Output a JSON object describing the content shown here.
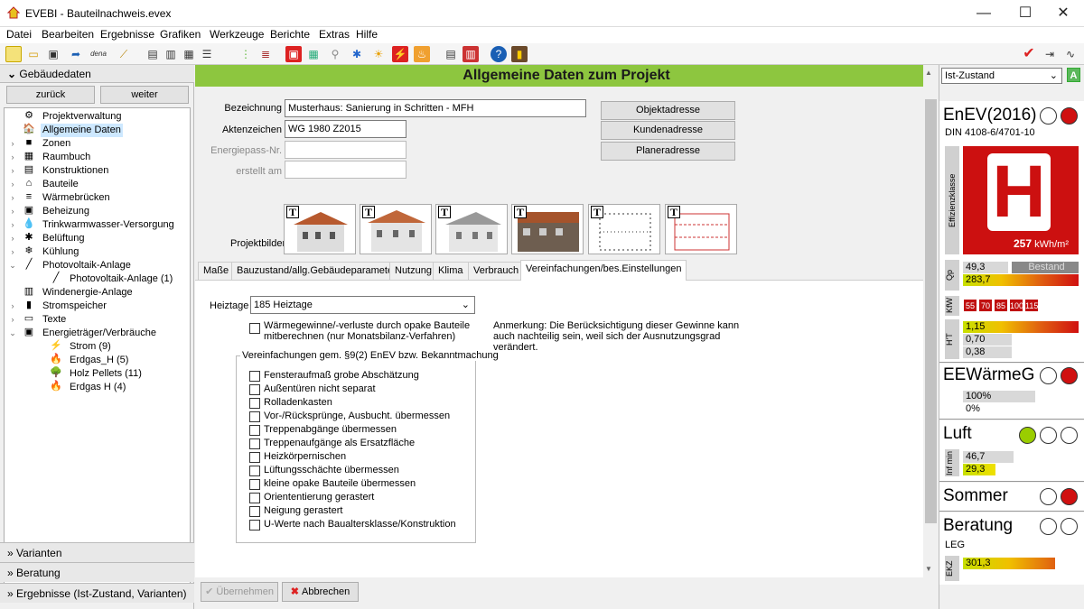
{
  "window": {
    "title": "EVEBI - Bauteilnachweis.evex",
    "minimize": "—",
    "maximize": "☐",
    "close": "✕"
  },
  "menu": [
    "Datei",
    "Bearbeiten",
    "Ergebnisse",
    "Grafiken",
    "Werkzeuge",
    "Berichte",
    "Extras",
    "Hilfe"
  ],
  "toolbar_dena": "dena",
  "left": {
    "header": "Gebäudedaten",
    "back": "zurück",
    "forward": "weiter",
    "tree": [
      {
        "label": "Projektverwaltung",
        "icon": "⚙",
        "exp": ""
      },
      {
        "label": "Allgemeine Daten",
        "icon": "🏠",
        "exp": "",
        "selected": true
      },
      {
        "label": "Zonen",
        "icon": "■",
        "exp": "›"
      },
      {
        "label": "Raumbuch",
        "icon": "▦",
        "exp": "›"
      },
      {
        "label": "Konstruktionen",
        "icon": "▤",
        "exp": "›"
      },
      {
        "label": "Bauteile",
        "icon": "⌂",
        "exp": "›"
      },
      {
        "label": "Wärmebrücken",
        "icon": "≡",
        "exp": "›"
      },
      {
        "label": "Beheizung",
        "icon": "▣",
        "exp": "›"
      },
      {
        "label": "Trinkwarmwasser-Versorgung",
        "icon": "💧",
        "exp": "›"
      },
      {
        "label": "Belüftung",
        "icon": "✱",
        "exp": "›"
      },
      {
        "label": "Kühlung",
        "icon": "❄",
        "exp": "›"
      },
      {
        "label": "Photovoltaik-Anlage",
        "icon": "╱",
        "exp": "⌄"
      },
      {
        "label": "Photovoltaik-Anlage (1)",
        "icon": "╱",
        "exp": "",
        "indent": true
      },
      {
        "label": "Windenergie-Anlage",
        "icon": "▥",
        "exp": ""
      },
      {
        "label": "Stromspeicher",
        "icon": "▮",
        "exp": "›"
      },
      {
        "label": "Texte",
        "icon": "▭",
        "exp": "›"
      },
      {
        "label": "Energieträger/Verbräuche",
        "icon": "▣",
        "exp": "⌄"
      },
      {
        "label": "Strom (9)",
        "icon": "⚡",
        "exp": "",
        "indent": true
      },
      {
        "label": "Erdgas_H (5)",
        "icon": "🔥",
        "exp": "",
        "indent": true
      },
      {
        "label": "Holz Pellets (11)",
        "icon": "🌳",
        "exp": "",
        "indent": true
      },
      {
        "label": "Erdgas H (4)",
        "icon": "🔥",
        "exp": "",
        "indent": true
      }
    ],
    "accordion": [
      "Varianten",
      "Beratung",
      "Ergebnisse (Ist-Zustand, Varianten)"
    ]
  },
  "main": {
    "header": "Allgemeine Daten zum Projekt",
    "fields": {
      "bezeichnung_label": "Bezeichnung",
      "bezeichnung_value": "Musterhaus: Sanierung in Schritten - MFH",
      "aktenzeichen_label": "Aktenzeichen",
      "aktenzeichen_value": "WG 1980 Z2015",
      "energiepass_label": "Energiepass-Nr.",
      "erstellt_label": "erstellt am"
    },
    "address_buttons": [
      "Objektadresse",
      "Kundenadresse",
      "Planeradresse"
    ],
    "projektbilder_label": "Projektbilder",
    "pic_t": "T",
    "tabs": [
      "Maße",
      "Bauzustand/allg.Gebäudeparameter",
      "Nutzung",
      "Klima",
      "Verbrauch",
      "Vereinfachungen/bes.Einstellungen"
    ],
    "heiztage_label": "Heiztage",
    "heiztage_value": "185 Heiztage",
    "waerme_check": "Wärmegewinne/-verluste durch opake Bauteile mitberechnen (nur Monatsbilanz-Verfahren)",
    "anmerkung": "Anmerkung: Die Berücksichtigung dieser Gewinne kann auch nachteilig sein, weil sich der Ausnutzungsgrad verändert.",
    "group_title": "Vereinfachungen gem. §9(2) EnEV bzw. Bekanntmachung",
    "checks": [
      "Fensteraufmaß grobe Abschätzung",
      "Außentüren nicht separat",
      "Rolladenkasten",
      "Vor-/Rücksprünge, Ausbucht. übermessen",
      "Treppenabgänge übermessen",
      "Treppenaufgänge als Ersatzfläche",
      "Heizkörpernischen",
      "Lüftungsschächte übermessen",
      "kleine opake Bauteile übermessen",
      "Oriententierung gerastert",
      "Neigung gerastert",
      "U-Werte nach Baualtersklasse/Konstruktion"
    ],
    "apply": "Übernehmen",
    "cancel": "Abbrechen"
  },
  "right": {
    "state": "Ist-Zustand",
    "state_badge": "A",
    "enev_title": "EnEV(2016)",
    "enev_sub": "DIN 4108-6/4701-10",
    "eff_label": "Effizienzklasse",
    "eff_class": "H",
    "eff_value": "257",
    "eff_unit": "kWh/m²",
    "qp_label": "Qp",
    "qp_values": [
      "49,3",
      "283,7"
    ],
    "bestand": "Bestand",
    "kfw_label": "KfW",
    "kfw_values": [
      "55",
      "70",
      "85",
      "100",
      "115"
    ],
    "ht_label": "H'T",
    "ht_values": [
      "1,15",
      "0,70",
      "0,38"
    ],
    "ee_title": "EEWärmeG",
    "ee_values": [
      "100%",
      "0%"
    ],
    "luft_title": "Luft",
    "luft_label": "Inf min",
    "luft_values": [
      "46,7",
      "29,3"
    ],
    "sommer_title": "Sommer",
    "beratung_title": "Beratung",
    "beratung_sub": "LEG",
    "ekz_label": "EKZ",
    "ekz_value": "301,3"
  },
  "colors": {
    "header_green": "#8dc63f",
    "eff_red": "#cc1010",
    "status_red": "#d01010",
    "status_green": "#9acd00"
  }
}
